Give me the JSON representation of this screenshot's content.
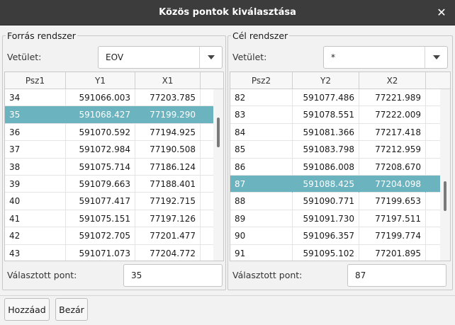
{
  "window": {
    "title": "Közös pontok kiválasztása",
    "close_glyph": "✕"
  },
  "source": {
    "group_title": "Forrás rendszer",
    "projection_label": "Vetület:",
    "projection_value": "EOV",
    "columns": [
      "Psz1",
      "Y1",
      "X1"
    ],
    "rows": [
      [
        "34",
        "591066.003",
        "77203.785"
      ],
      [
        "35",
        "591068.427",
        "77199.290"
      ],
      [
        "36",
        "591070.592",
        "77194.925"
      ],
      [
        "37",
        "591072.984",
        "77190.508"
      ],
      [
        "38",
        "591075.714",
        "77186.124"
      ],
      [
        "39",
        "591079.663",
        "77188.401"
      ],
      [
        "40",
        "591077.417",
        "77192.715"
      ],
      [
        "41",
        "591075.151",
        "77197.126"
      ],
      [
        "42",
        "591072.705",
        "77201.477"
      ],
      [
        "43",
        "591071.073",
        "77204.772"
      ]
    ],
    "selected_row": 1,
    "selected_label": "Választott pont:",
    "selected_value": "35"
  },
  "target": {
    "group_title": "Cél rendszer",
    "projection_label": "Vetület:",
    "projection_value": "*",
    "columns": [
      "Psz2",
      "Y2",
      "X2"
    ],
    "rows": [
      [
        "82",
        "591077.486",
        "77221.989"
      ],
      [
        "83",
        "591078.551",
        "77222.009"
      ],
      [
        "84",
        "591081.366",
        "77217.418"
      ],
      [
        "85",
        "591083.798",
        "77212.959"
      ],
      [
        "86",
        "591086.008",
        "77208.670"
      ],
      [
        "87",
        "591088.425",
        "77204.098"
      ],
      [
        "88",
        "591090.771",
        "77199.653"
      ],
      [
        "89",
        "591091.730",
        "77197.511"
      ],
      [
        "90",
        "591096.357",
        "77199.774"
      ],
      [
        "91",
        "591095.102",
        "77201.895"
      ]
    ],
    "selected_row": 5,
    "selected_label": "Választott pont:",
    "selected_value": "87"
  },
  "buttons": {
    "add": "Hozzáad",
    "close": "Bezár"
  },
  "colors": {
    "titlebar": "#3c3c3c",
    "selection": "#6ab3bf",
    "dialog_bg": "#f2f2f2"
  }
}
